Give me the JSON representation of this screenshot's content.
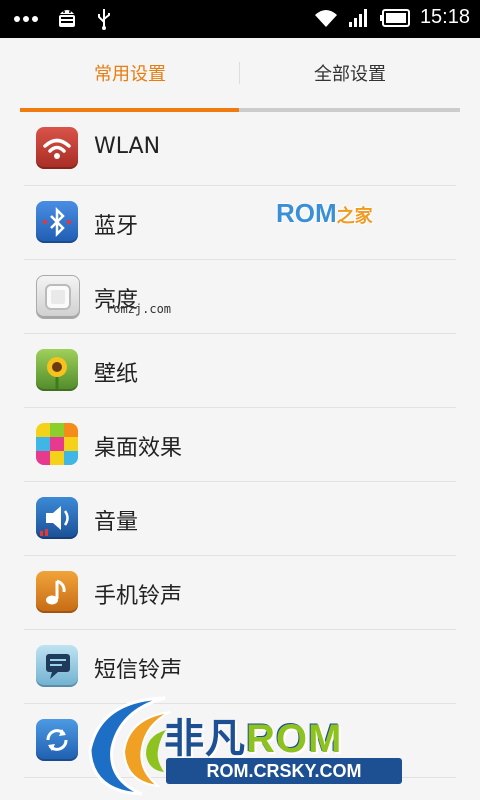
{
  "status_bar": {
    "time": "15:18",
    "icons": [
      "more-dots-icon",
      "android-debug-icon",
      "usb-icon",
      "wifi-icon",
      "signal-icon",
      "battery-icon"
    ]
  },
  "tabs": [
    {
      "label": "常用设置",
      "active": true
    },
    {
      "label": "全部设置",
      "active": false
    }
  ],
  "settings": [
    {
      "label": "WLAN",
      "icon": "wifi-icon"
    },
    {
      "label": "蓝牙",
      "icon": "bluetooth-icon"
    },
    {
      "label": "亮度",
      "icon": "brightness-icon"
    },
    {
      "label": "壁纸",
      "icon": "wallpaper-icon"
    },
    {
      "label": "桌面效果",
      "icon": "desktop-effects-icon"
    },
    {
      "label": "音量",
      "icon": "volume-icon"
    },
    {
      "label": "手机铃声",
      "icon": "ringtone-icon"
    },
    {
      "label": "短信铃声",
      "icon": "sms-ringtone-icon"
    },
    {
      "label": "",
      "icon": "sync-icon"
    }
  ],
  "watermarks": {
    "rom_home_main": "ROM",
    "rom_home_suffix": "之家",
    "url": "romzj.com",
    "logo_cn": "非凡",
    "logo_rom": "ROM",
    "logo_url": "ROM.CRSKY.COM"
  },
  "colors": {
    "accent": "#f07c10",
    "list_bg": "#f5f5f5",
    "status_bar_bg": "#000000"
  }
}
